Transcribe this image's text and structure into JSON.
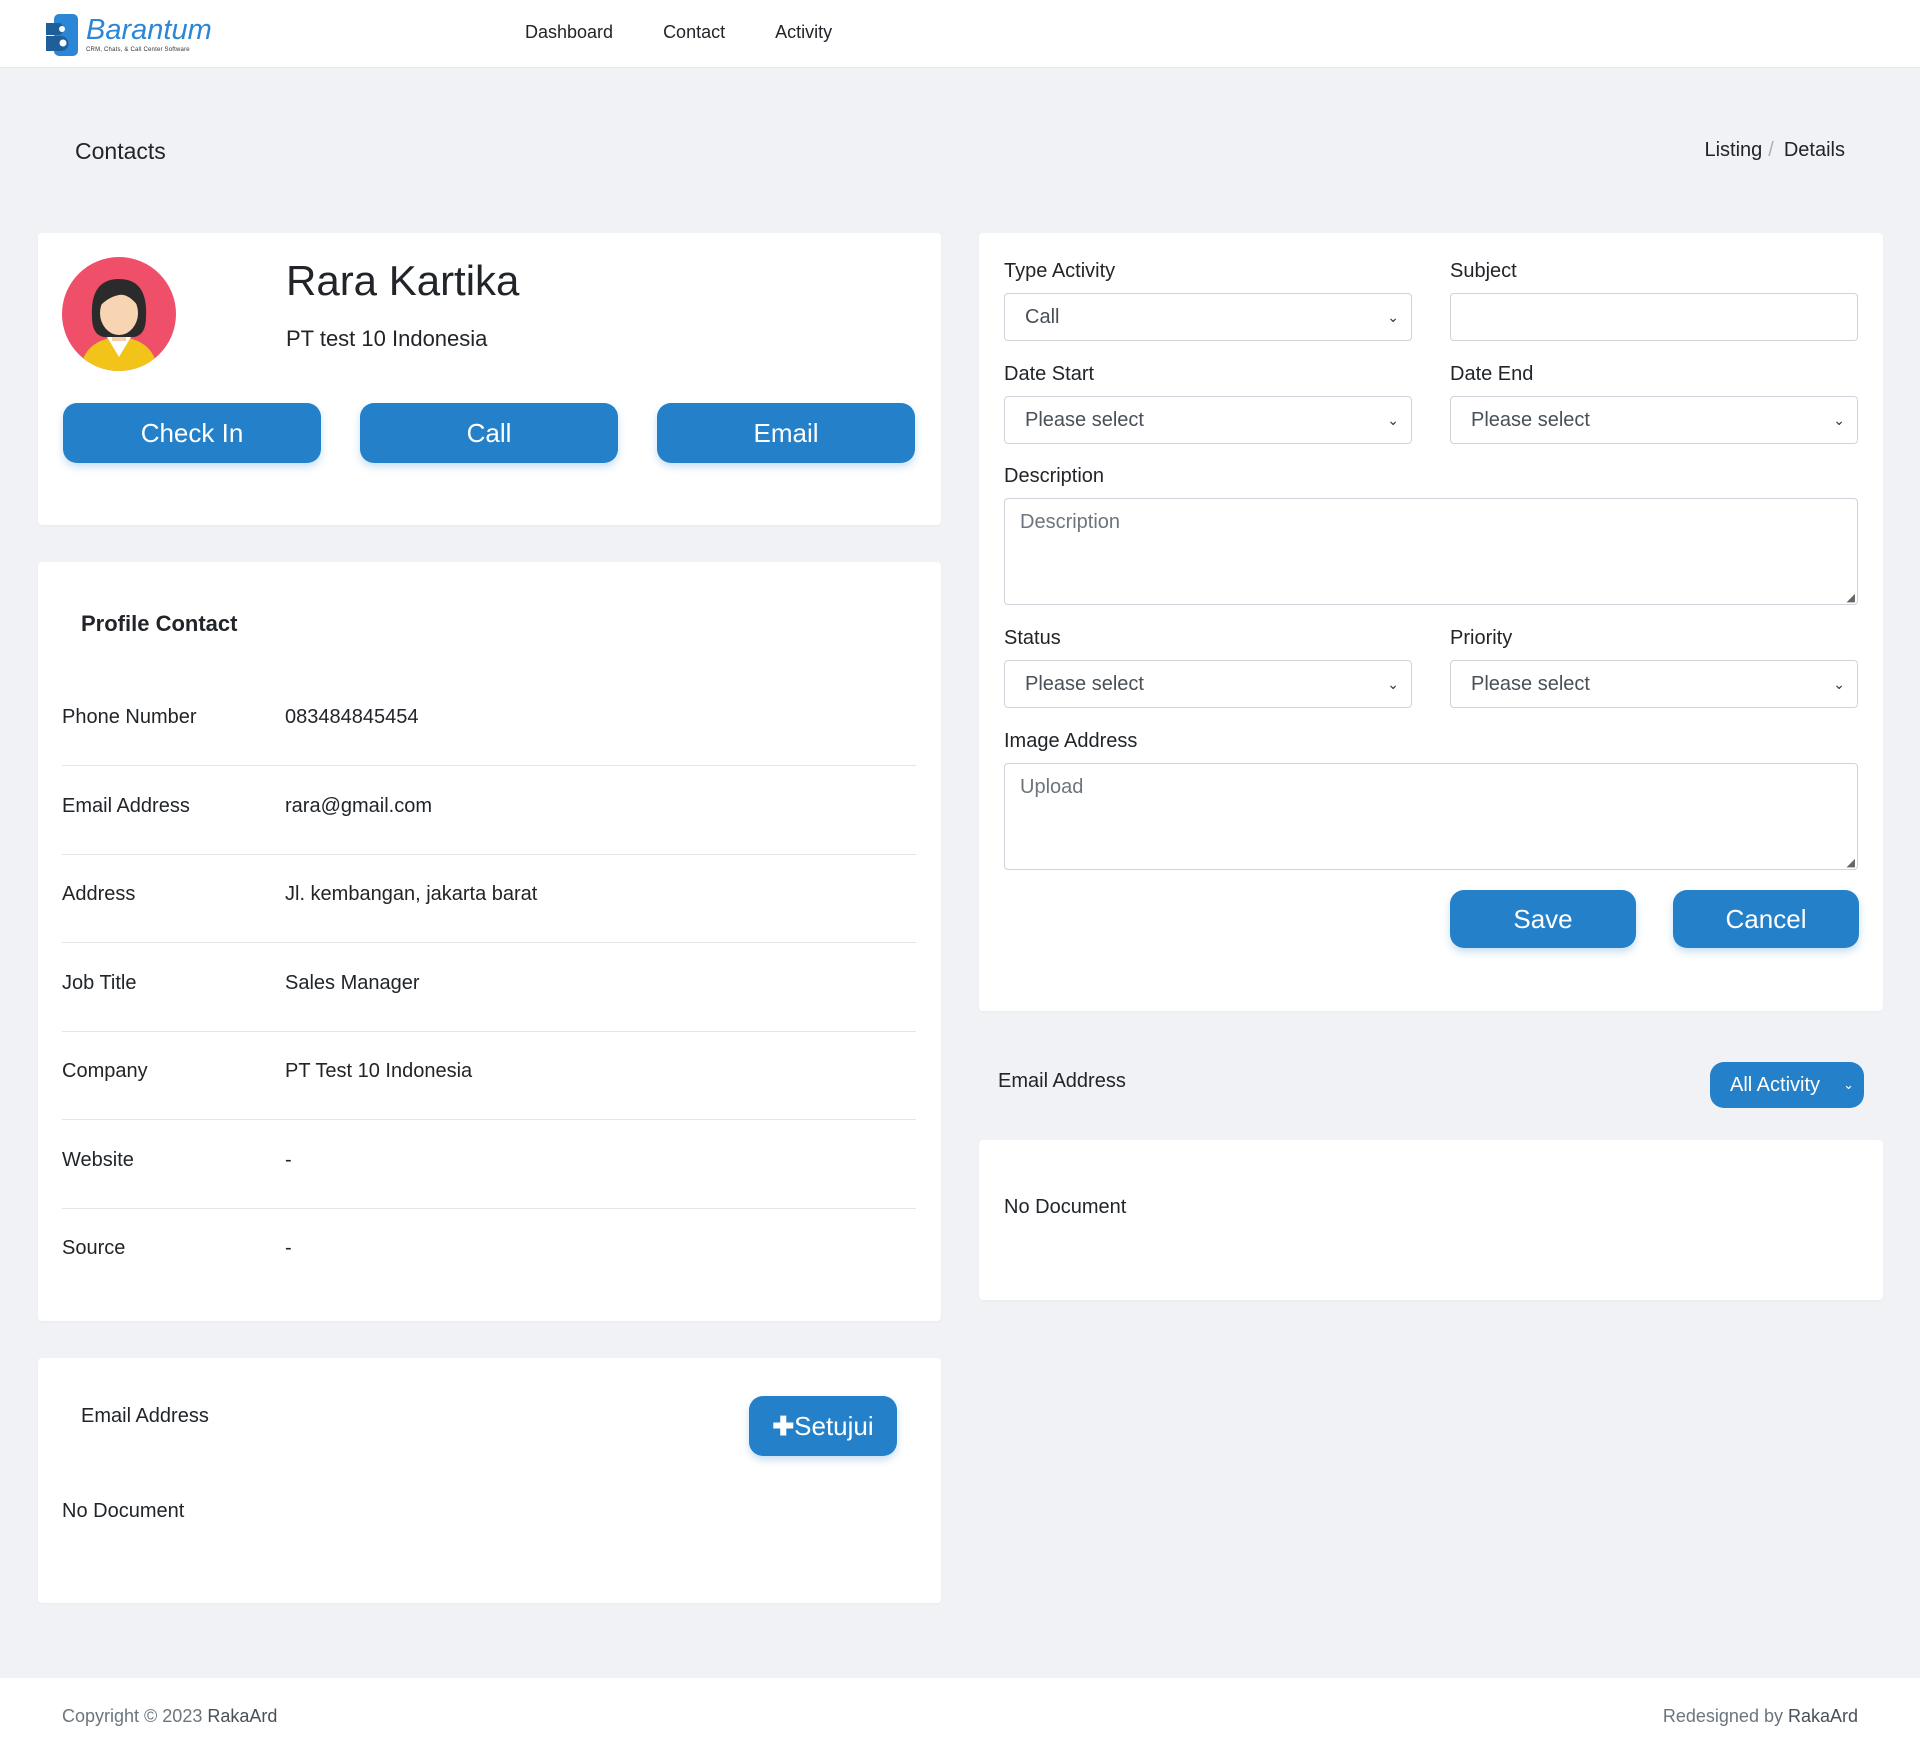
{
  "brand": {
    "name": "Barantum",
    "tagline": "CRM, Chats, & Call Center Software",
    "accent": "#2480c9"
  },
  "nav": {
    "items": [
      "Dashboard",
      "Contact",
      "Activity"
    ]
  },
  "page": {
    "title": "Contacts",
    "breadcrumb": [
      "Listing",
      "Details"
    ]
  },
  "profile": {
    "name": "Rara Kartika",
    "company": "PT test 10 Indonesia",
    "buttons": {
      "check_in": "Check In",
      "call": "Call",
      "email": "Email"
    }
  },
  "profile_contact": {
    "heading": "Profile Contact",
    "fields": [
      {
        "label": "Phone Number",
        "value": "083484845454"
      },
      {
        "label": "Email Address",
        "value": "rara@gmail.com"
      },
      {
        "label": "Address",
        "value": "Jl. kembangan, jakarta barat"
      },
      {
        "label": "Job Title",
        "value": "Sales Manager"
      },
      {
        "label": "Company",
        "value": "PT Test 10 Indonesia"
      },
      {
        "label": "Website",
        "value": "-"
      },
      {
        "label": "Source",
        "value": "-"
      }
    ]
  },
  "email_card_left": {
    "label": "Email Address",
    "button": "Setujui",
    "empty": "No Document"
  },
  "activity_form": {
    "type_activity": {
      "label": "Type Activity",
      "value": "Call"
    },
    "subject": {
      "label": "Subject",
      "value": ""
    },
    "date_start": {
      "label": "Date Start",
      "value": "Please select"
    },
    "date_end": {
      "label": "Date End",
      "value": "Please select"
    },
    "description": {
      "label": "Description",
      "placeholder": "Description"
    },
    "status": {
      "label": "Status",
      "value": "Please select"
    },
    "priority": {
      "label": "Priority",
      "value": "Please select"
    },
    "image_address": {
      "label": "Image Address",
      "placeholder": "Upload"
    },
    "save": "Save",
    "cancel": "Cancel"
  },
  "activity_list": {
    "label": "Email Address",
    "filter": "All Activity",
    "empty": "No Document"
  },
  "footer": {
    "copyright": "Copyright © 2023 ",
    "copyright_owner": "RakaArd",
    "credit": "Redesigned by ",
    "credit_owner": "RakaArd"
  }
}
